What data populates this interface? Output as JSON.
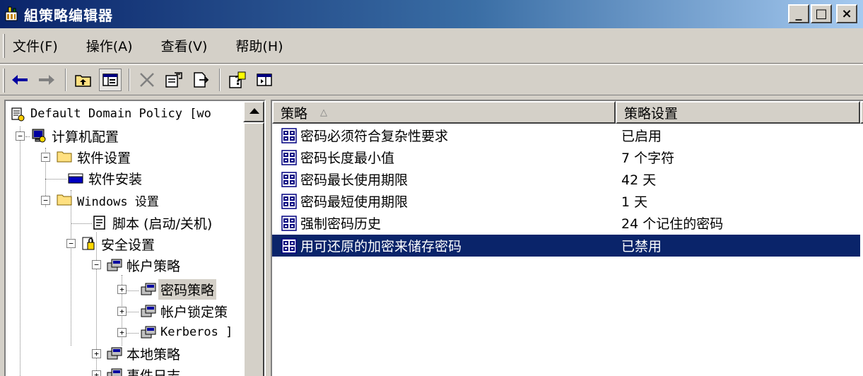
{
  "window": {
    "title": "組策略编辑器",
    "controls": {
      "minimize": "_",
      "maximize": "□",
      "close": "×"
    }
  },
  "menu": [
    {
      "label": "文件(F)"
    },
    {
      "label": "操作(A)"
    },
    {
      "label": "查看(V)"
    },
    {
      "label": "帮助(H)"
    }
  ],
  "toolbar": {
    "icons": [
      "back-arrow-icon",
      "forward-arrow-icon",
      "up-folder-icon",
      "show-hide-tree-icon",
      "delete-icon",
      "properties-icon",
      "export-list-icon",
      "help-icon",
      "console-icon"
    ]
  },
  "tree": {
    "nodes": [
      {
        "label": "Default Domain Policy [wo"
      },
      {
        "label": "计算机配置"
      },
      {
        "label": "软件设置"
      },
      {
        "label": "软件安装"
      },
      {
        "label": "Windows 设置"
      },
      {
        "label": "脚本 (启动/关机)"
      },
      {
        "label": "安全设置"
      },
      {
        "label": "帐户策略"
      },
      {
        "label": "密码策略"
      },
      {
        "label": "帐户锁定策"
      },
      {
        "label": "Kerberos ]"
      },
      {
        "label": "本地策略"
      },
      {
        "label": "事件日志"
      }
    ],
    "expanders": {
      "collapsed": "+",
      "expanded": "−"
    }
  },
  "list": {
    "columns": [
      {
        "label": "策略",
        "sort_glyph": "△"
      },
      {
        "label": "策略设置"
      }
    ],
    "rows": [
      {
        "name": "密码必须符合复杂性要求",
        "setting": "已启用"
      },
      {
        "name": "密码长度最小值",
        "setting": "7 个字符"
      },
      {
        "name": "密码最长使用期限",
        "setting": "42 天"
      },
      {
        "name": "密码最短使用期限",
        "setting": "1 天"
      },
      {
        "name": "强制密码历史",
        "setting": "24 个记住的密码"
      },
      {
        "name": "用可还原的加密来储存密码",
        "setting": "已禁用"
      }
    ]
  },
  "colors": {
    "title_start": "#0a246a",
    "title_end": "#a6caf0",
    "selection": "#0a246a",
    "face": "#d4d0c8"
  }
}
